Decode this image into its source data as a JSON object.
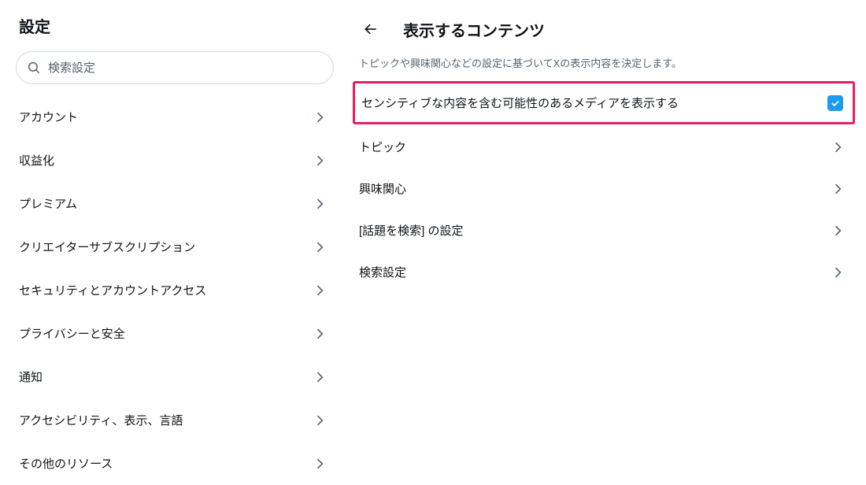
{
  "colors": {
    "highlight_border": "#e91e63",
    "checkbox_bg": "#1d9bf0",
    "text_secondary": "#536471"
  },
  "sidebar": {
    "title": "設定",
    "search_placeholder": "検索設定",
    "items": [
      {
        "label": "アカウント"
      },
      {
        "label": "収益化"
      },
      {
        "label": "プレミアム"
      },
      {
        "label": "クリエイターサブスクリプション"
      },
      {
        "label": "セキュリティとアカウントアクセス"
      },
      {
        "label": "プライバシーと安全"
      },
      {
        "label": "通知"
      },
      {
        "label": "アクセシビリティ、表示、言語"
      },
      {
        "label": "その他のリソース"
      }
    ]
  },
  "main": {
    "title": "表示するコンテンツ",
    "description": "トピックや興味関心などの設定に基づいてXの表示内容を決定します。",
    "sensitive_toggle": {
      "label": "センシティブな内容を含む可能性のあるメディアを表示する",
      "checked": true
    },
    "items": [
      {
        "label": "トピック"
      },
      {
        "label": "興味関心"
      },
      {
        "label": "[話題を検索] の設定"
      },
      {
        "label": "検索設定"
      }
    ]
  }
}
